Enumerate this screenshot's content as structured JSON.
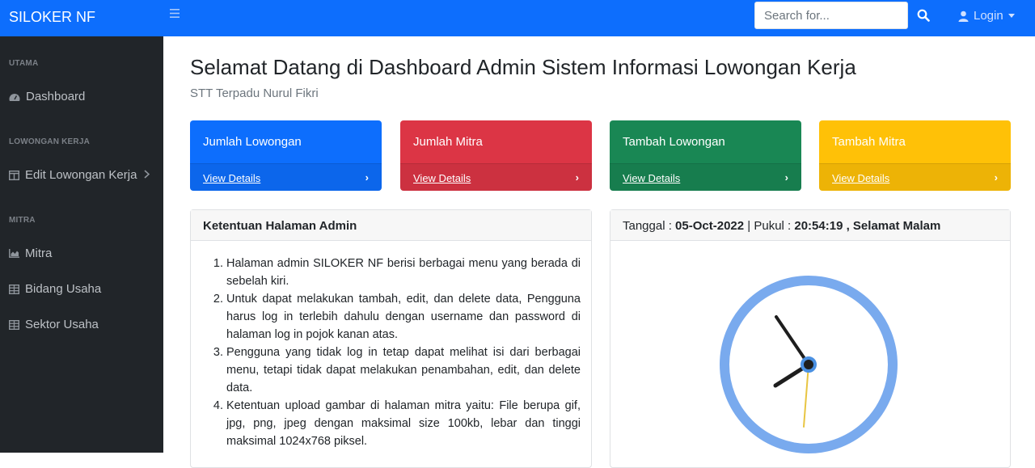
{
  "brand": "SILOKER NF",
  "search": {
    "placeholder": "Search for..."
  },
  "login_label": "Login",
  "sidebar": {
    "sections": [
      {
        "heading": "UTAMA",
        "items": [
          {
            "label": "Dashboard",
            "icon": "dashboard-icon"
          }
        ]
      },
      {
        "heading": "LOWONGAN KERJA",
        "items": [
          {
            "label": "Edit Lowongan Kerja",
            "icon": "columns-icon"
          }
        ]
      },
      {
        "heading": "MITRA",
        "items": [
          {
            "label": "Mitra",
            "icon": "chart-area-icon"
          },
          {
            "label": "Bidang Usaha",
            "icon": "table-icon"
          },
          {
            "label": "Sektor Usaha",
            "icon": "table-icon"
          }
        ]
      }
    ]
  },
  "page": {
    "title": "Selamat Datang di Dashboard Admin Sistem Informasi Lowongan Kerja",
    "subtitle": "STT Terpadu Nurul Fikri"
  },
  "cards": [
    {
      "title": "Jumlah Lowongan",
      "link": "View Details",
      "color": "#0d6efd"
    },
    {
      "title": "Jumlah Mitra",
      "link": "View Details",
      "color": "#dc3545"
    },
    {
      "title": "Tambah Lowongan",
      "link": "View Details",
      "color": "#198754"
    },
    {
      "title": "Tambah Mitra",
      "link": "View Details",
      "color": "#ffc107"
    }
  ],
  "rules_panel": {
    "title": "Ketentuan Halaman Admin",
    "items": [
      "Halaman admin SILOKER NF berisi berbagai menu yang berada di sebelah kiri.",
      "Untuk dapat melakukan tambah, edit, dan delete data, Pengguna harus log in terlebih dahulu dengan username dan password di halaman log in pojok kanan atas.",
      "Pengguna yang tidak log in tetap dapat melihat isi dari berbagai menu, tetapi tidak dapat melakukan penambahan, edit, dan delete data.",
      "Ketentuan upload gambar di halaman mitra yaitu: File berupa gif, jpg, png, jpeg dengan maksimal size 100kb, lebar dan tinggi maksimal 1024x768 piksel."
    ]
  },
  "clock_panel": {
    "date_label": "Tanggal : ",
    "date": "05-Oct-2022",
    "time_label": " | Pukul : ",
    "time": "20:54:19",
    "greeting": " , Selamat Malam"
  }
}
